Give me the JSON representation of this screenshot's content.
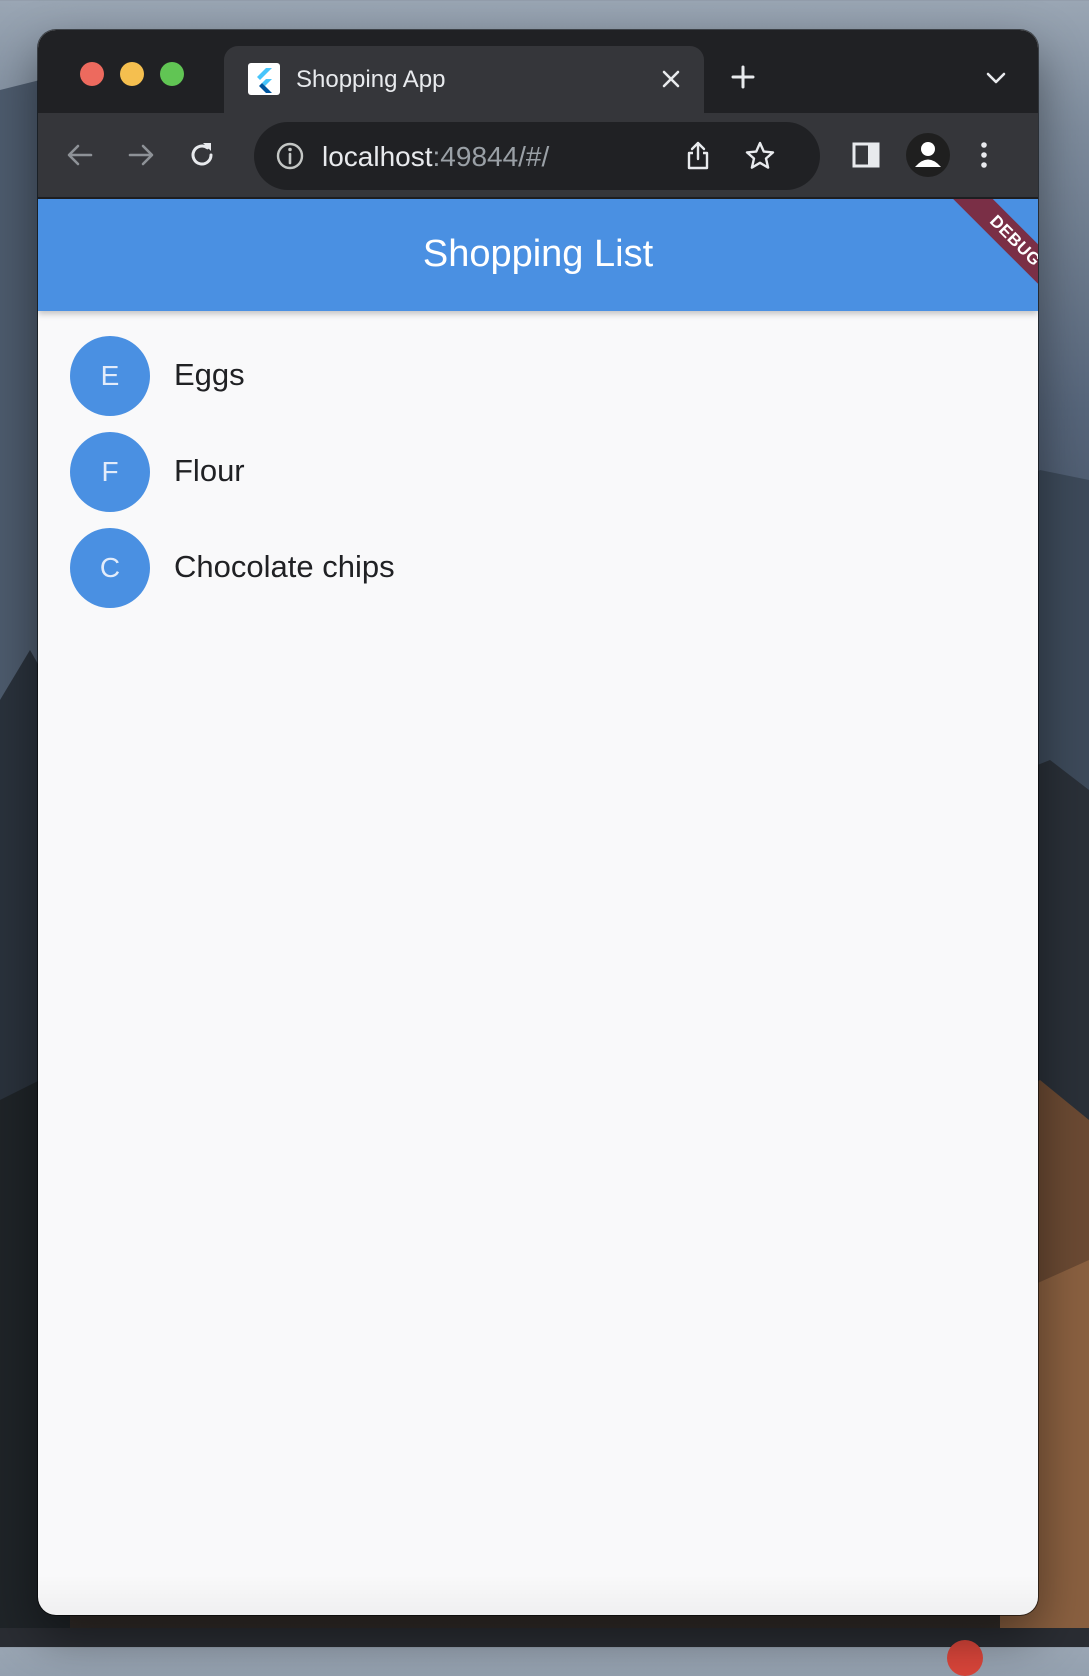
{
  "browser": {
    "tab": {
      "title": "Shopping App",
      "favicon": "flutter-logo-icon"
    },
    "url": {
      "host": "localhost",
      "rest": ":49844/#/"
    },
    "icons": [
      "back-icon",
      "forward-icon",
      "reload-icon",
      "info-icon",
      "share-icon",
      "bookmark-star-icon",
      "side-panel-icon",
      "profile-icon",
      "menu-icon"
    ]
  },
  "app": {
    "title": "Shopping List",
    "debug_banner": "DEBUG",
    "accent_color": "#4a90e2",
    "items": [
      {
        "initial": "E",
        "name": "Eggs"
      },
      {
        "initial": "F",
        "name": "Flour"
      },
      {
        "initial": "C",
        "name": "Chocolate chips"
      }
    ]
  }
}
